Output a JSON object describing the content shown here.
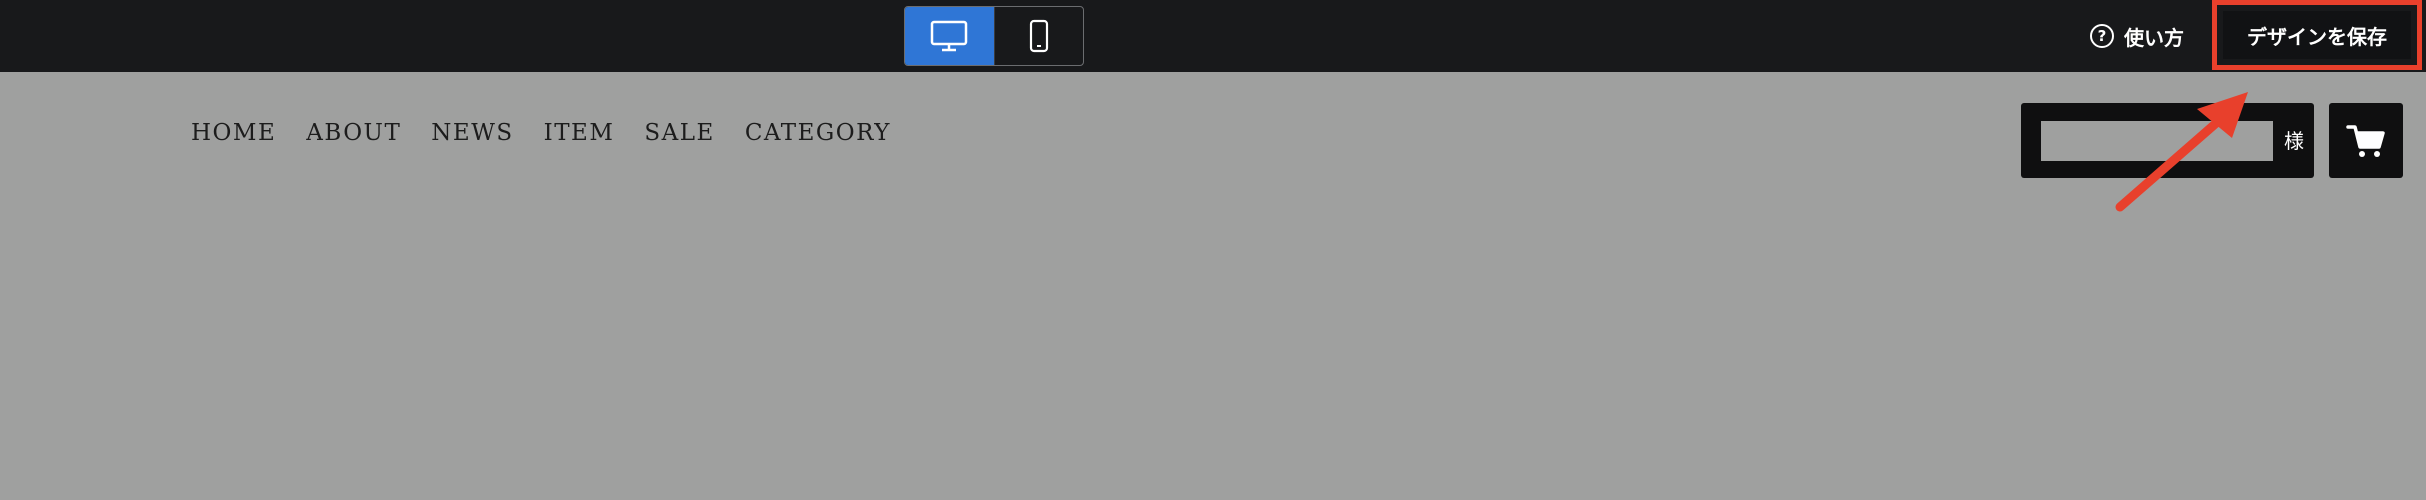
{
  "toolbar": {
    "view_modes": [
      {
        "icon": "desktop-icon",
        "active": true
      },
      {
        "icon": "mobile-icon",
        "active": false
      }
    ],
    "help_label": "使い方",
    "save_label": "デザインを保存",
    "accent_color": "#2f76d6",
    "highlight_color": "#e8402c"
  },
  "store_header": {
    "nav": [
      "HOME",
      "ABOUT",
      "NEWS",
      "ITEM",
      "SALE",
      "CATEGORY"
    ],
    "member_suffix": "様",
    "cart_icon": "cart-icon"
  }
}
